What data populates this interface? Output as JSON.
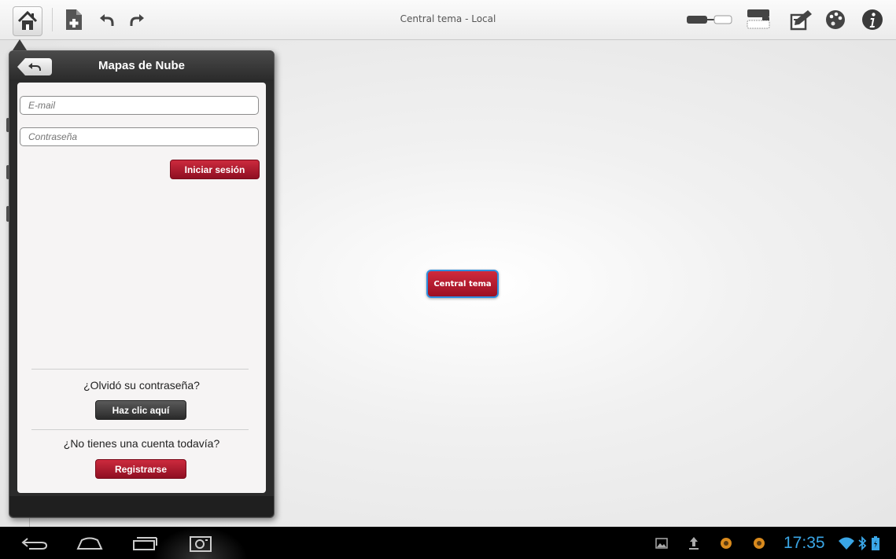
{
  "window": {
    "title": "Central tema - Local"
  },
  "toolbar": {
    "icons": [
      "home-icon",
      "new-document-icon",
      "undo-icon",
      "redo-icon",
      "layout-toggle-icon",
      "map-structure-icon",
      "edit-note-icon",
      "palette-icon",
      "info-icon"
    ]
  },
  "canvas": {
    "central_topic": "Central tema"
  },
  "cloud_panel": {
    "title": "Mapas de Nube",
    "email_placeholder": "E-mail",
    "password_placeholder": "Contraseña",
    "login_label": "Iniciar sesión",
    "forgot_text": "¿Olvidó su contraseña?",
    "click_here_label": "Haz clic aquí",
    "no_account_text": "¿No tienes una cuenta todavía?",
    "register_label": "Registrarse"
  },
  "system_bar": {
    "clock": "17:35",
    "icons": [
      "back-icon",
      "home-nav-icon",
      "recent-apps-icon",
      "screenshot-icon",
      "gallery-icon",
      "upload-icon",
      "app-notification-icon",
      "app-notification-icon-2",
      "wifi-icon",
      "bluetooth-icon",
      "battery-icon"
    ]
  },
  "colors": {
    "accent_red": "#b51b2f",
    "selection_blue": "#2e8fe0",
    "clock_blue": "#3aa6e6"
  }
}
